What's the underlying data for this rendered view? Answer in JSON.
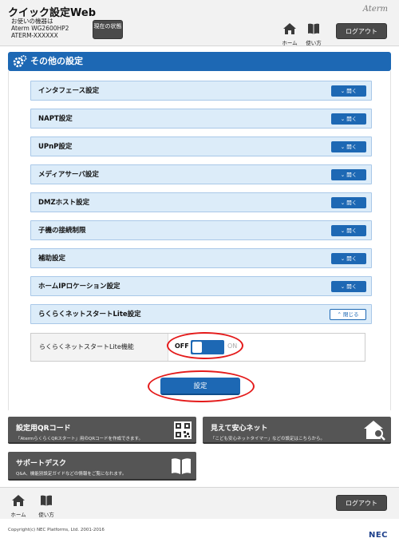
{
  "header": {
    "title": "クイック設定Web",
    "device_label": "お使いの機器は",
    "device_model": "Aterm WG2600HP2",
    "device_id": "ATERM-XXXXXX",
    "status_button": "現在の状態",
    "brand": "Aterm",
    "home_label": "ホーム",
    "manual_label": "使い方",
    "logout_label": "ログアウト"
  },
  "section": {
    "title": "その他の設定"
  },
  "accordion": [
    {
      "label": "インタフェース設定",
      "button": "開く"
    },
    {
      "label": "NAPT設定",
      "button": "開く"
    },
    {
      "label": "UPnP設定",
      "button": "開く"
    },
    {
      "label": "メディアサーバ設定",
      "button": "開く"
    },
    {
      "label": "DMZホスト設定",
      "button": "開く"
    },
    {
      "label": "子機の接続制限",
      "button": "開く"
    },
    {
      "label": "補助設定",
      "button": "開く"
    },
    {
      "label": "ホームIPロケーション設定",
      "button": "開く"
    },
    {
      "label": "らくらくネットスタートLite設定",
      "button": "閉じる"
    }
  ],
  "panel": {
    "label": "らくらくネットスタートLite機能",
    "toggle_off": "OFF",
    "toggle_on": "ON",
    "toggle_state": "OFF"
  },
  "submit_label": "設定",
  "tiles": {
    "qr": {
      "title": "設定用QRコード",
      "desc": "「AtermらくらくQRスタート」用のQRコードを作成できます。"
    },
    "safe": {
      "title": "見えて安心ネット",
      "desc": "「こども安心ネットタイマー」などの設定はこちらから。"
    },
    "support": {
      "title": "サポートデスク",
      "desc": "Q&A、機能別設定ガイドなどの情報をご覧になれます。"
    }
  },
  "footer": {
    "home_label": "ホーム",
    "manual_label": "使い方",
    "logout_label": "ログアウト",
    "copyright": "Copyright(c) NEC Platforms, Ltd. 2001-2016",
    "logo": "NEC"
  },
  "colors": {
    "accent": "#1d68b4",
    "row_bg": "#dcecf9",
    "dark_button": "#4a4a4a",
    "tile_bg": "#555555",
    "highlight": "#e41b1b"
  }
}
